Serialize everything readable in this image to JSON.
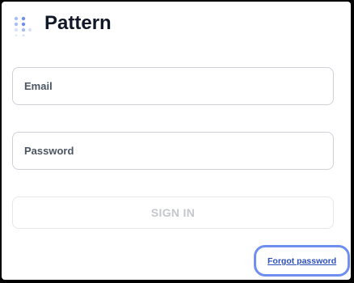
{
  "brand": {
    "title": "Pattern",
    "logo_icon": "dot-grid-logo-icon",
    "accent_color": "#6f8ff0"
  },
  "form": {
    "email_label": "Email",
    "password_label": "Password",
    "submit_label": "SIGN IN",
    "forgot_label": "Forgot password"
  }
}
